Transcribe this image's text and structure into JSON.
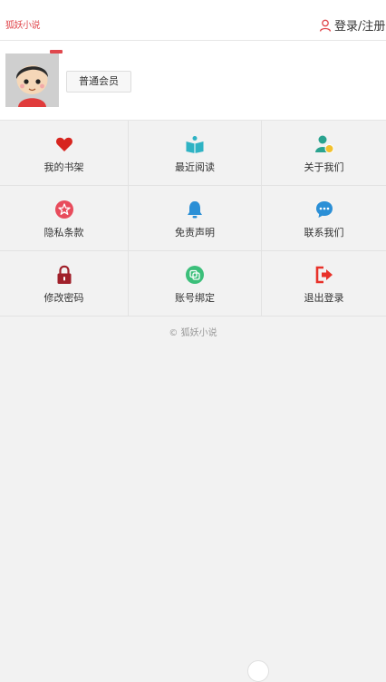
{
  "header": {
    "logo_text": "狐妖小说",
    "login_label": "登录/注册",
    "icons": {
      "login": "user-outline-icon"
    }
  },
  "profile": {
    "member_level": "普通会员",
    "avatar_icon": "cartoon-avatar"
  },
  "menu": [
    {
      "label": "我的书架",
      "icon": "heart-icon",
      "color": "#d7251f"
    },
    {
      "label": "最近阅读",
      "icon": "open-book-icon",
      "color": "#2fb3c4"
    },
    {
      "label": "关于我们",
      "icon": "user-coin-icon",
      "color": "#2aa38f"
    },
    {
      "label": "隐私条款",
      "icon": "star-badge-icon",
      "color": "#e84c5c"
    },
    {
      "label": "免责声明",
      "icon": "bell-icon",
      "color": "#2b8fd6"
    },
    {
      "label": "联系我们",
      "icon": "chat-bubble-icon",
      "color": "#2b8fd6"
    },
    {
      "label": "修改密码",
      "icon": "lock-icon",
      "color": "#a0202a"
    },
    {
      "label": "账号绑定",
      "icon": "link-icon",
      "color": "#3bbf7a"
    },
    {
      "label": "退出登录",
      "icon": "logout-icon",
      "color": "#e8322a"
    }
  ],
  "footer": {
    "copyright": "© 狐妖小说"
  },
  "colors": {
    "accent": "#e0484d",
    "background": "#f2f2f2"
  }
}
